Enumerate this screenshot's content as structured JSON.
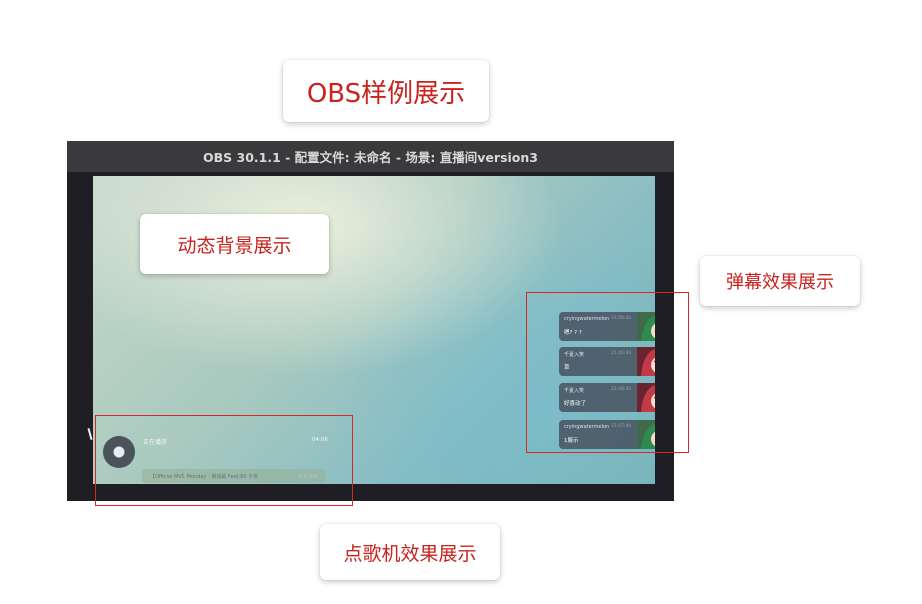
{
  "callouts": {
    "title": "OBS样例展示",
    "background": "动态背景展示",
    "danmaku": "弹幕效果展示",
    "player": "点歌机效果展示"
  },
  "window": {
    "title": "OBS 30.1.1 - 配置文件: 未命名 - 场景: 直播间version3"
  },
  "danmaku": {
    "items": [
      {
        "name": "cryingwatermelon",
        "time": "21:50:42",
        "text": "嗯? ? ?",
        "avatar": "green-hair-avatar-icon"
      },
      {
        "name": "千夏入笑",
        "time": "21:45:43",
        "text": "草",
        "avatar": "red-hair-heart-eyes-avatar-icon"
      },
      {
        "name": "千夏入笑",
        "time": "21:48:42",
        "text": "好喜动了",
        "avatar": "red-hair-heart-eyes-avatar-icon"
      },
      {
        "name": "cryingwatermelon",
        "time": "21:57:40",
        "text": "1展示",
        "avatar": "green-hair-avatar-icon"
      }
    ]
  },
  "player": {
    "status": "正在播放",
    "time": "04:06",
    "song": "【Official MV】Monday - 第城最 Feat.Bll 子安",
    "action": "暂无歌曲"
  },
  "colors": {
    "accent": "#c8231f",
    "highlight_box": "#d42a23",
    "window_bg": "#1f1e25",
    "titlebar_bg": "#3a3a3c"
  }
}
